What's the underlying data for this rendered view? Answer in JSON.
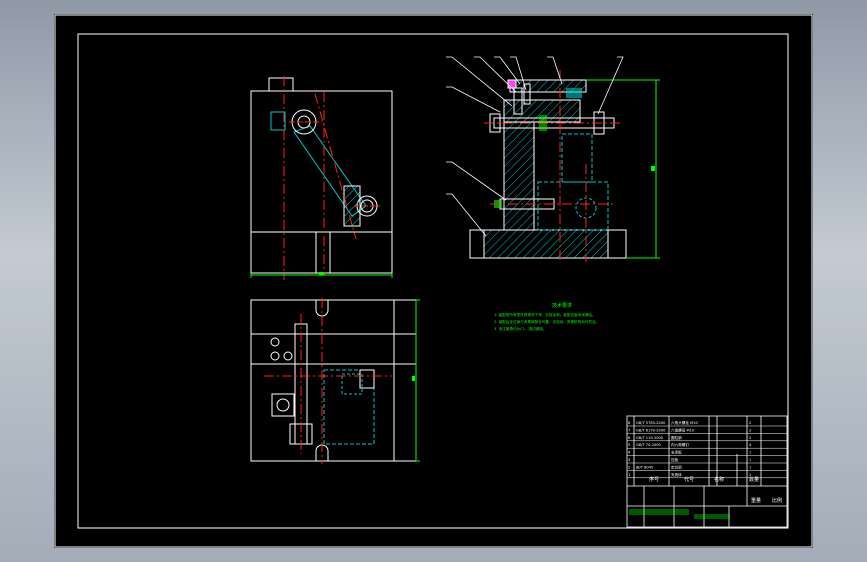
{
  "tech_requirements": {
    "title": "技术要求",
    "lines": [
      "1. 装配前所有零件须清洗干净，去除毛刺；各配合面涂润滑油。",
      "2. 装配后定位销与夹具体配合可靠，无松动，夹紧机构动作灵活。",
      "3. 未注倒角均为C1，锐边倒钝。"
    ]
  },
  "title_block": {
    "rows": [
      [
        "8",
        "GB/T 5783-2000",
        "六角头螺栓 M10",
        "2"
      ],
      [
        "7",
        "GB/T 6170-2000",
        "六角螺母 M10",
        "2"
      ],
      [
        "6",
        "GB/T 119-2000",
        "圆柱销",
        "2"
      ],
      [
        "5",
        "GB/T 70-2000",
        "内六角螺钉",
        "4"
      ],
      [
        "4",
        "",
        "支承板",
        "1"
      ],
      [
        "3",
        "",
        "压板",
        "1"
      ],
      [
        "2",
        "JB/T 8045",
        "定位销",
        "1"
      ],
      [
        "1",
        "",
        "夹具体",
        "1"
      ]
    ],
    "headers": [
      "序号",
      "代号",
      "名称",
      "数量"
    ],
    "weight_label": "重量",
    "scale_label": "比例"
  },
  "colors": {
    "outline": "#ffffff",
    "center": "#ff2020",
    "hidden": "#00c8c8",
    "dimension": "#00ff00",
    "leader": "#ffffff",
    "hatch": "#00c8c8",
    "note": "#00ff00"
  }
}
